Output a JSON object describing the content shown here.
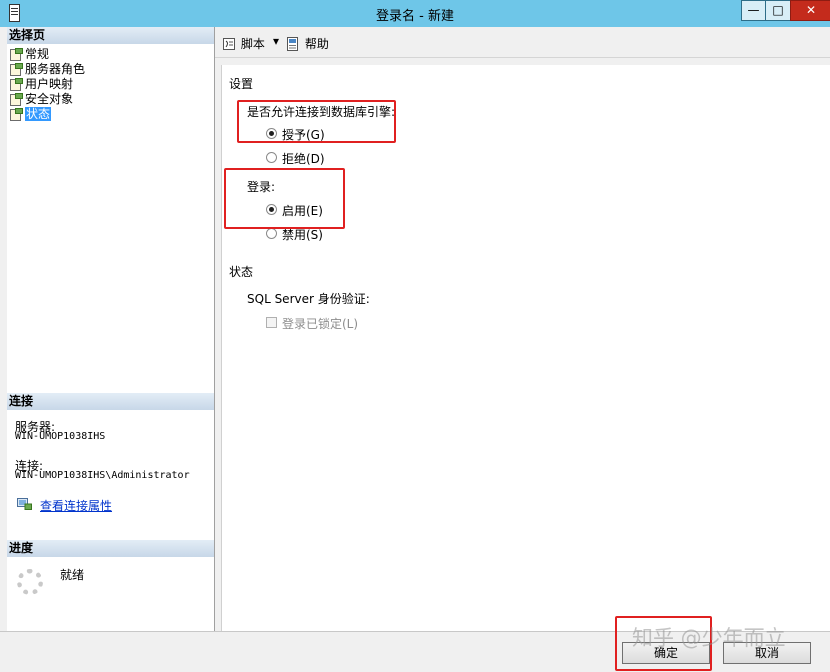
{
  "window": {
    "title": "登录名 - 新建",
    "minimize": "—",
    "maximize": "□",
    "close": "✕"
  },
  "left_panel": {
    "select_page_header": "选择页",
    "pages": [
      {
        "label": "常规",
        "selected": false
      },
      {
        "label": "服务器角色",
        "selected": false
      },
      {
        "label": "用户映射",
        "selected": false
      },
      {
        "label": "安全对象",
        "selected": false
      },
      {
        "label": "状态",
        "selected": true
      }
    ],
    "connection_header": "连接",
    "server_label": "服务器:",
    "server_value": "WIN-UMOP1038IHS",
    "connection_label": "连接:",
    "connection_value": "WIN-UMOP1038IHS\\Administrator",
    "view_connection_link": "查看连接属性",
    "progress_header": "进度",
    "progress_status": "就绪"
  },
  "toolbar": {
    "script_label": "脚本",
    "help_label": "帮助"
  },
  "settings": {
    "section_label": "设置",
    "permission_question": "是否允许连接到数据库引擎:",
    "grant_label": "授予(G)",
    "deny_label": "拒绝(D)",
    "login_label": "登录:",
    "enable_label": "启用(E)",
    "disable_label": "禁用(S)",
    "grant_selected": true,
    "enable_selected": true
  },
  "status": {
    "section_label": "状态",
    "sql_auth_label": "SQL Server 身份验证:",
    "locked_label": "登录已锁定(L)",
    "locked_checked": false
  },
  "buttons": {
    "ok_label": "确定",
    "cancel_label": "取消"
  },
  "watermark": "知乎 @少年而立",
  "colors": {
    "titlebar": "#6ec6e8",
    "highlight": "#e02020",
    "selection": "#3399ff",
    "link": "#0033cc"
  }
}
